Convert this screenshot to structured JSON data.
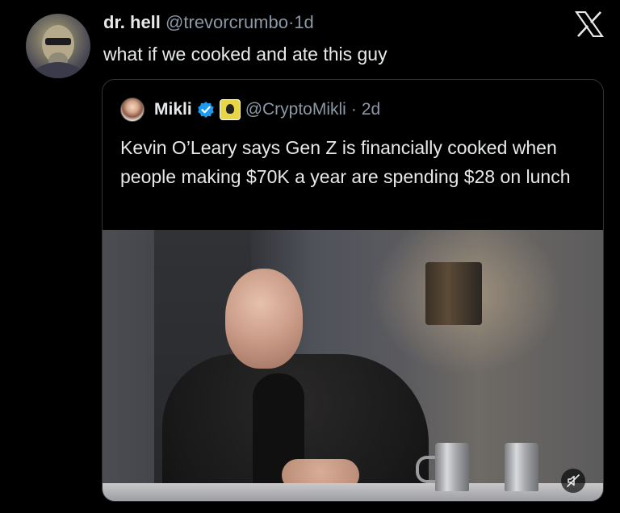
{
  "post": {
    "display_name": "dr. hell",
    "handle": "@trevorcrumbo",
    "separator": "·",
    "time": "1d",
    "text": "what if we cooked and ate this guy"
  },
  "quote": {
    "display_name": "Mikli",
    "handle": "@CryptoMikli",
    "separator": "·",
    "time": "2d",
    "text": "Kevin O’Leary says Gen Z is financially cooked when people making $70K a year are spending $28 on lunch"
  },
  "icons": {
    "brand": "x-logo-icon",
    "verified": "verified-badge-icon",
    "affiliate": "affiliate-badge-icon",
    "mute": "muted-speaker-icon"
  },
  "colors": {
    "background": "#000000",
    "primary_text": "#e7e9ea",
    "secondary_text": "#8b98a5",
    "border": "#2f3336",
    "verified_blue": "#1d9bf0"
  }
}
